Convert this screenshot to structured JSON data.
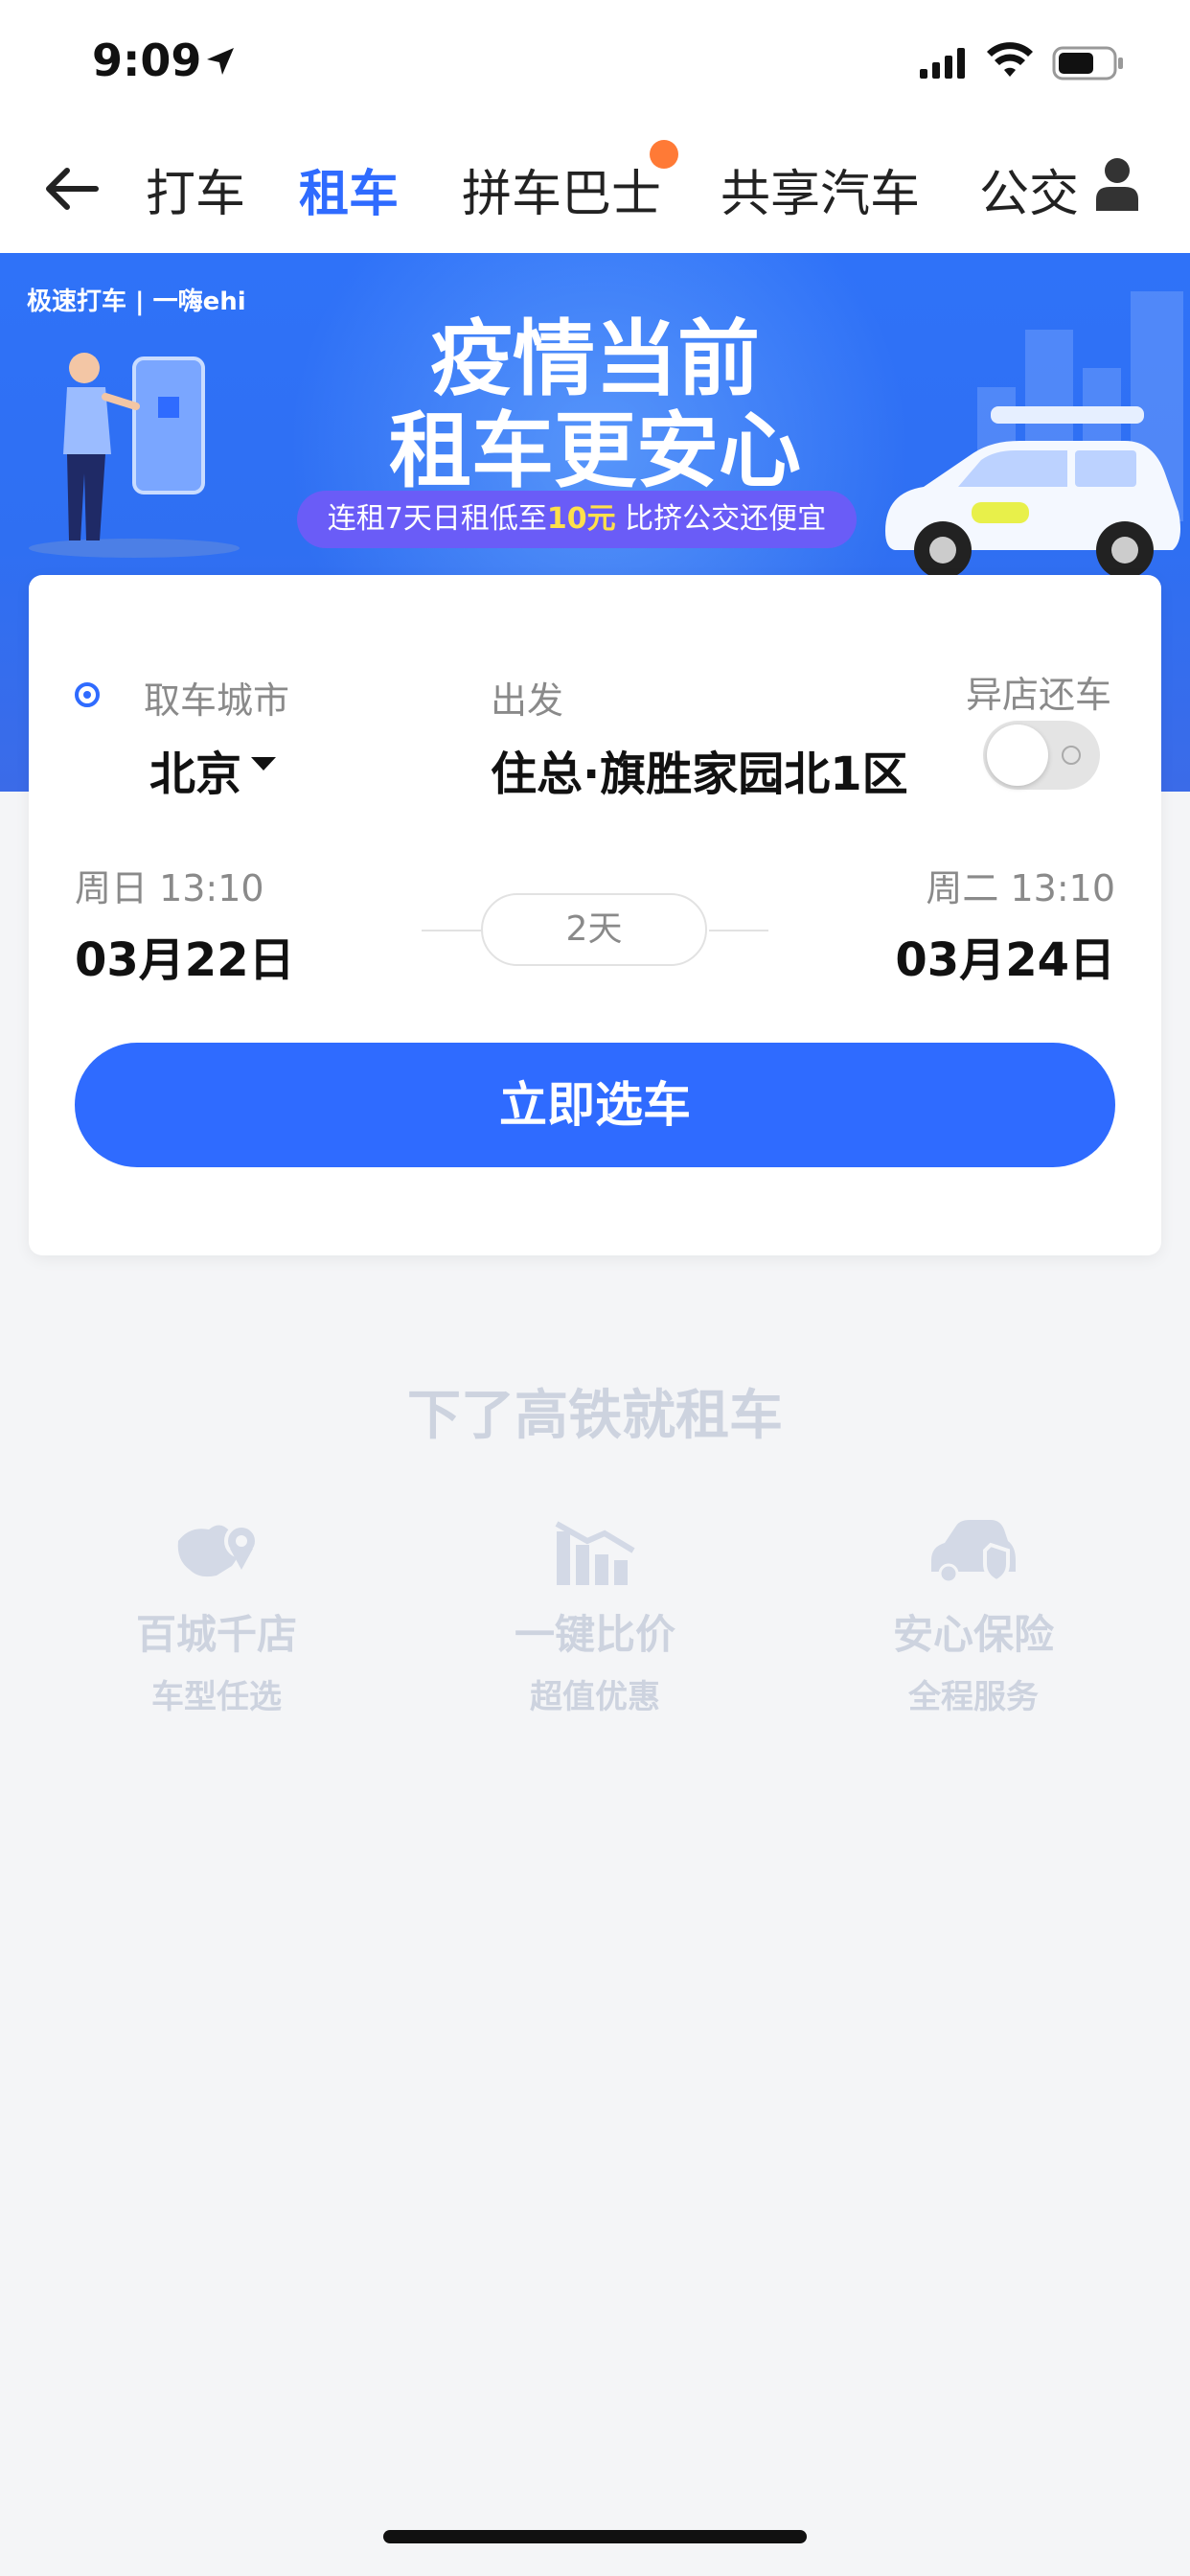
{
  "status_bar": {
    "time": "9:09"
  },
  "nav": {
    "tabs": [
      {
        "label": "打车",
        "active": false
      },
      {
        "label": "租车",
        "active": true
      },
      {
        "label": "拼车巴士",
        "active": false,
        "badge": true
      },
      {
        "label": "共享汽车",
        "active": false
      },
      {
        "label": "公交",
        "active": false
      }
    ],
    "accent_color": "#2f6bff",
    "badge_color": "#ff7a36"
  },
  "banner": {
    "brand": "极速打车 | 一嗨ehi",
    "line1": "疫情当前",
    "line2": "租车更安心",
    "pill_prefix": "连租7天日租低至",
    "pill_highlight": "10元",
    "pill_suffix": " 比挤公交还便宜"
  },
  "booking": {
    "pickup_city_label": "取车城市",
    "pickup_city": "北京",
    "depart_label": "出发",
    "depart_location": "住总·旗胜家园北1区",
    "return_diff_label": "异店还车",
    "return_diff_enabled": false,
    "start_weekday_time": "周日 13:10",
    "start_date": "03月22日",
    "duration": "2天",
    "end_weekday_time": "周二 13:10",
    "end_date": "03月24日",
    "cta_label": "立即选车"
  },
  "features": {
    "title": "下了高铁就租车",
    "items": [
      {
        "title": "百城千店",
        "subtitle": "车型任选",
        "icon": "china-map-pin-icon"
      },
      {
        "title": "一键比价",
        "subtitle": "超值优惠",
        "icon": "price-chart-icon"
      },
      {
        "title": "安心保险",
        "subtitle": "全程服务",
        "icon": "car-shield-icon"
      }
    ]
  }
}
